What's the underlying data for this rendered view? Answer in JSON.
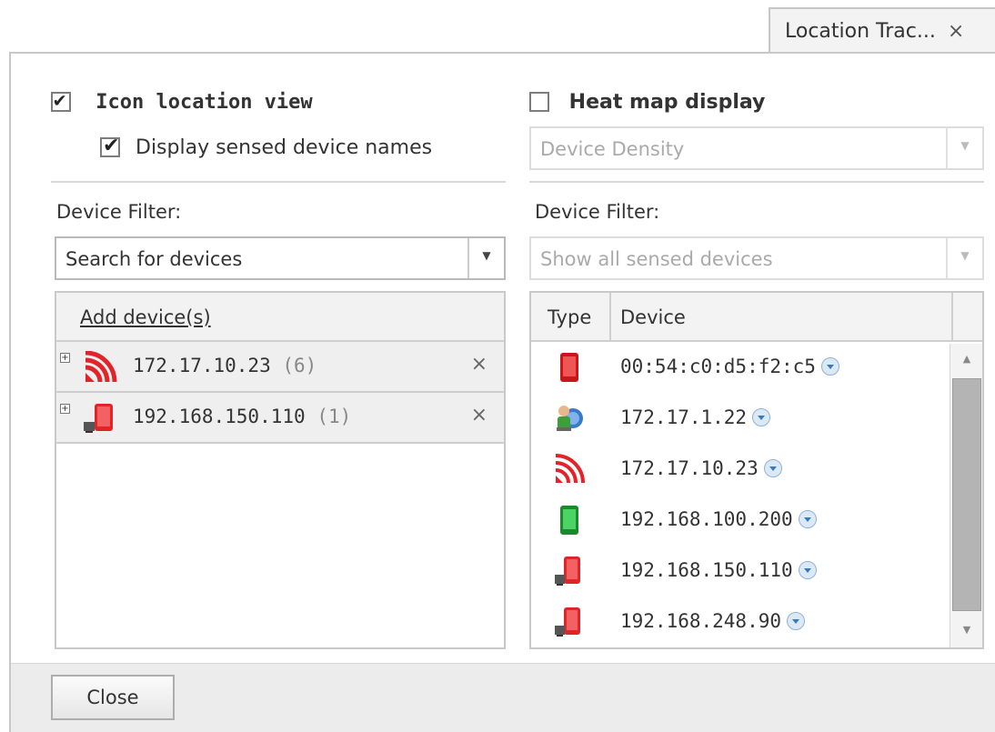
{
  "tab": {
    "label": "Location Trac...",
    "close_glyph": "×"
  },
  "options": {
    "icon_location_view": {
      "label": "Icon location view",
      "checked": true
    },
    "display_sensed_names": {
      "label": "Display sensed device names",
      "checked": true
    },
    "heat_map_display": {
      "label": "Heat map display",
      "checked": false
    }
  },
  "heat_map": {
    "mode_value": "Device Density"
  },
  "left_filter": {
    "label": "Device Filter:",
    "search_value": "Search for devices",
    "add_link": "Add device(s)",
    "items": [
      {
        "name": "172.17.10.23",
        "count": "(6)",
        "icon": "wireless-ap-icon",
        "remove": "×"
      },
      {
        "name": "192.168.150.110",
        "count": "(1)",
        "icon": "mobile-device-red-icon",
        "remove": "×"
      }
    ]
  },
  "right_filter": {
    "label": "Device Filter:",
    "select_value": "Show all sensed devices",
    "columns": {
      "type": "Type",
      "device": "Device"
    },
    "rows": [
      {
        "device": "00:54:c0:d5:f2:c5",
        "icon": "phone-red-icon"
      },
      {
        "device": "172.17.1.22",
        "icon": "user-computer-icon"
      },
      {
        "device": "172.17.10.23",
        "icon": "wireless-ap-icon"
      },
      {
        "device": "192.168.100.200",
        "icon": "phone-green-icon"
      },
      {
        "device": "192.168.150.110",
        "icon": "mobile-device-red-icon"
      },
      {
        "device": "192.168.248.90",
        "icon": "mobile-device-red-icon"
      }
    ]
  },
  "footer": {
    "close_label": "Close"
  },
  "colors": {
    "accent_red": "#e0242a",
    "green": "#2bbf45",
    "panel_border": "#c8c8c8",
    "footer_bg": "#ececec"
  }
}
